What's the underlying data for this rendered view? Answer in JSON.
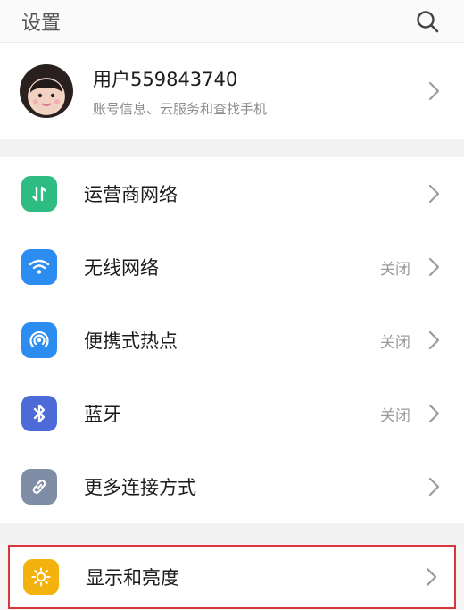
{
  "header": {
    "title": "设置",
    "search_icon": "search-icon"
  },
  "account": {
    "name": "用户559843740",
    "subtitle": "账号信息、云服务和查找手机"
  },
  "settings": [
    {
      "label": "运营商网络",
      "value": "",
      "icon": "swap-arrows-icon",
      "color": "#2dbd82"
    },
    {
      "label": "无线网络",
      "value": "关闭",
      "icon": "wifi-icon",
      "color": "#2d8cf0"
    },
    {
      "label": "便携式热点",
      "value": "关闭",
      "icon": "hotspot-icon",
      "color": "#2d8cf0"
    },
    {
      "label": "蓝牙",
      "value": "关闭",
      "icon": "bluetooth-icon",
      "color": "#4d6bd8"
    },
    {
      "label": "更多连接方式",
      "value": "",
      "icon": "link-icon",
      "color": "#7f8da6"
    }
  ],
  "display": {
    "label": "显示和亮度",
    "icon": "sun-icon",
    "color": "#f4b20f"
  }
}
